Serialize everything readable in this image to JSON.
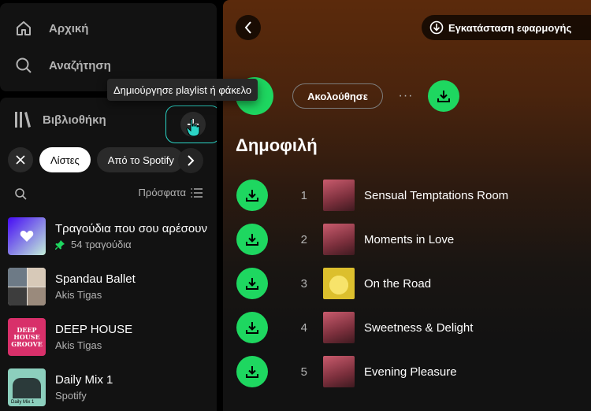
{
  "nav": {
    "home_label": "Αρχική",
    "search_label": "Αναζήτηση"
  },
  "library": {
    "title": "Βιβλιοθήκη",
    "create_tooltip": "Δημιούργησε playlist ή φάκελο",
    "chips": [
      "Λίστες",
      "Από το Spotify"
    ],
    "sort_label": "Πρόσφατα",
    "items": [
      {
        "title": "Τραγούδια που σου αρέσουν",
        "subtitle": "54 τραγούδια",
        "pinned": true,
        "thumb_icon": "heart-icon"
      },
      {
        "title": "Spandau Ballet",
        "subtitle": "Akis Tigas",
        "pinned": false
      },
      {
        "title": "DEEP HOUSE",
        "subtitle": "Akis Tigas",
        "pinned": false,
        "thumb_text": [
          "DEEP",
          "HOUSE",
          "GROOVE"
        ]
      },
      {
        "title": "Daily Mix 1",
        "subtitle": "Spotify",
        "pinned": false,
        "thumb_text": "Daily Mix 1"
      }
    ]
  },
  "main": {
    "install_label": "Εγκατάσταση εφαρμογής",
    "follow_label": "Ακολούθησε",
    "more_label": "···",
    "section_title": "Δημοφιλή",
    "tracks": [
      {
        "num": "1",
        "title": "Sensual Temptations Room",
        "art": "pink"
      },
      {
        "num": "2",
        "title": "Moments in Love",
        "art": "pink"
      },
      {
        "num": "3",
        "title": "On the Road",
        "art": "yellow"
      },
      {
        "num": "4",
        "title": "Sweetness & Delight",
        "art": "pink"
      },
      {
        "num": "5",
        "title": "Evening Pleasure",
        "art": "pink"
      }
    ]
  },
  "colors": {
    "accent_green": "#1ed760",
    "focus_ring": "#2bd5c6",
    "sidebar_bg": "#121212",
    "header_gradient_top": "#5b2a0c"
  }
}
